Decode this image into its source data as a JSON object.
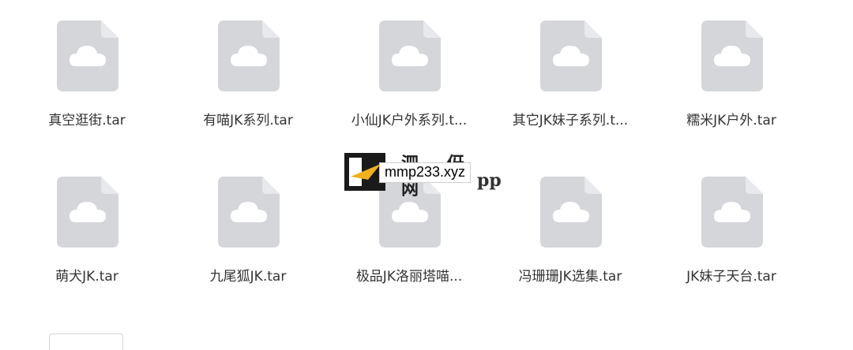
{
  "files": [
    {
      "name": "真空逛街.tar",
      "icon": "cloud-file-icon"
    },
    {
      "name": "有喵JK系列.tar",
      "icon": "cloud-file-icon"
    },
    {
      "name": "小仙JK户外系列.t...",
      "icon": "cloud-file-icon"
    },
    {
      "name": "其它JK妹子系列.t...",
      "icon": "cloud-file-icon"
    },
    {
      "name": "糯米JK户外.tar",
      "icon": "cloud-file-icon"
    },
    {
      "name": "萌犬JK.tar",
      "icon": "cloud-file-icon"
    },
    {
      "name": "九尾狐JK.tar",
      "icon": "cloud-file-icon"
    },
    {
      "name": "极品JK洛丽塔喵...",
      "icon": "cloud-file-icon"
    },
    {
      "name": "冯珊珊JK选集.tar",
      "icon": "cloud-file-icon"
    },
    {
      "name": "JK妹子天台.tar",
      "icon": "cloud-file-icon"
    }
  ],
  "watermark": {
    "label": "mmp233.xyz",
    "cn_text": "泗 伢 网",
    "app_text": "pp"
  },
  "colors": {
    "icon_body": "#d4d6da",
    "icon_fold": "#e8e9ec",
    "cloud": "#ffffff",
    "text": "#333333"
  }
}
